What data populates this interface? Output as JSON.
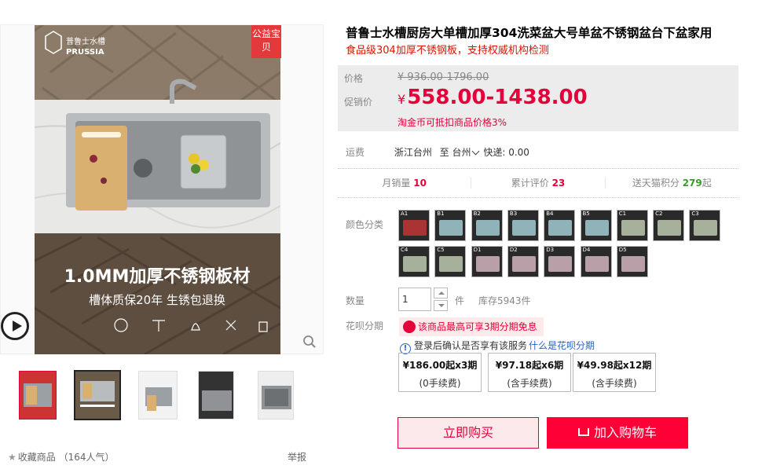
{
  "gallery": {
    "promo_tag": "公益宝贝",
    "brand_name_cn": "普鲁士水槽",
    "brand_name_en": "PRUSSIA",
    "headline": "1.0MM加厚不锈钢板材",
    "tagline": "槽体质保20年  生锈包退换",
    "thumb_count": 5
  },
  "favorite": {
    "label": "收藏商品",
    "popularity": "（164人气）"
  },
  "report_label": "举报",
  "product": {
    "title": "普鲁士水槽厨房大单槽加厚304洗菜盆大号单盆不锈钢盆台下盆家用",
    "subtitle": "食品级304加厚不锈钢板，支持权威机构检测"
  },
  "price": {
    "orig_label": "价格",
    "orig_value": "¥ 936.00-1796.00",
    "promo_label": "促销价",
    "currency": "¥",
    "promo_value": "558.00-1438.00",
    "coin_note": "淘金币可抵扣商品价格3%"
  },
  "shipping": {
    "label": "运费",
    "from": "浙江台州",
    "to_prefix": "至",
    "to": "台州",
    "express": "快递: 0.00"
  },
  "stats": [
    {
      "label": "月销量",
      "value": "10",
      "suffix": ""
    },
    {
      "label": "累计评价",
      "value": "23",
      "suffix": ""
    },
    {
      "label": "送天猫积分",
      "value": "279",
      "suffix": "起"
    }
  ],
  "colors": {
    "label": "颜色分类",
    "swatches": [
      "A1",
      "B1",
      "B2",
      "B3",
      "B4",
      "B5",
      "C1",
      "C2",
      "C3",
      "C4",
      "C5",
      "D1",
      "D2",
      "D3",
      "D4",
      "D5"
    ]
  },
  "quantity": {
    "label": "数量",
    "value": "1",
    "unit": "件",
    "stock": "库存5943件"
  },
  "huabei": {
    "label": "花呗分期",
    "promo": "该商品最高可享3期分期免息",
    "note": "登录后确认是否享有该服务",
    "link": "什么是花呗分期",
    "plans": [
      {
        "amount": "¥186.00起x3期",
        "fee": "(0手续费)"
      },
      {
        "amount": "¥97.18起x6期",
        "fee": "(含手续费)"
      },
      {
        "amount": "¥49.98起x12期",
        "fee": "(含手续费)"
      }
    ]
  },
  "actions": {
    "buy_now": "立即购买",
    "add_cart": "加入购物车"
  },
  "theme": {
    "accent": "#e4003a",
    "cart_red": "#ff0036",
    "link_blue": "#2a62c9"
  }
}
